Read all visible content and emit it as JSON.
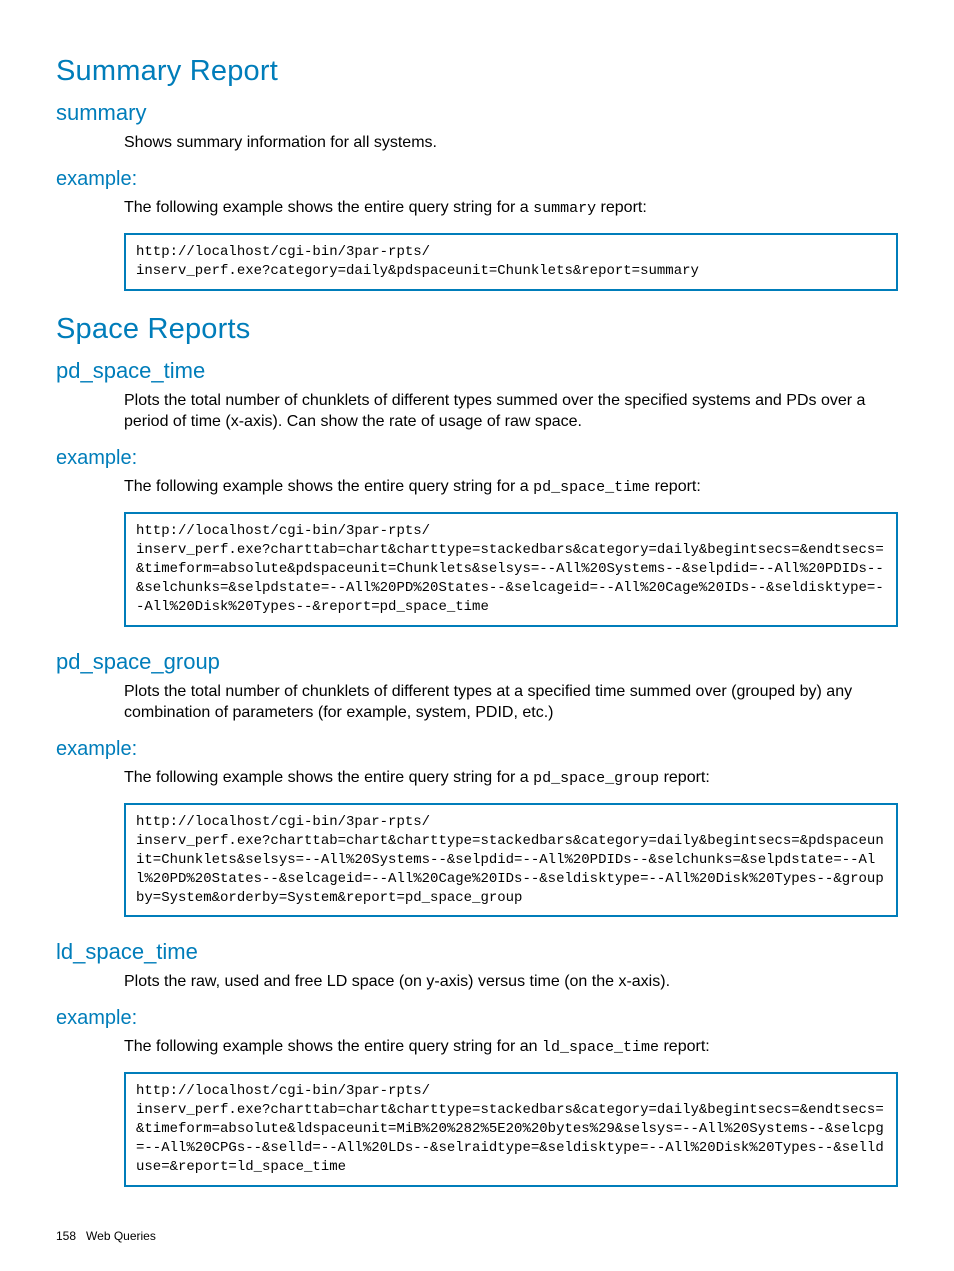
{
  "headings": {
    "summary_report": "Summary Report",
    "summary": "summary",
    "example": "example:",
    "space_reports": "Space Reports",
    "pd_space_time": "pd_space_time",
    "pd_space_group": "pd_space_group",
    "ld_space_time": "ld_space_time"
  },
  "text": {
    "summary_desc": "Shows summary information for all systems.",
    "summary_example_prefix": "The following example shows the entire query string for a ",
    "summary_example_code": "summary",
    "summary_example_suffix": " report:",
    "pd_space_time_desc": "Plots the total number of chunklets of different types summed over the specified systems and PDs over a period of time (x-axis). Can show the rate of usage of raw space.",
    "pd_space_time_example_prefix": "The following example shows the entire query string for a ",
    "pd_space_time_example_code": "pd_space_time",
    "pd_space_time_example_suffix": " report:",
    "pd_space_group_desc": "Plots the total number of chunklets of different types at a specified time summed over (grouped by) any combination of parameters (for example, system, PDID, etc.)",
    "pd_space_group_example_prefix": "The following example shows the entire query string for a ",
    "pd_space_group_example_code": "pd_space_group",
    "pd_space_group_example_suffix": " report:",
    "ld_space_time_desc": "Plots the raw, used and free LD space (on y-axis) versus time (on the x-axis).",
    "ld_space_time_example_prefix": "The following example shows the entire query string for an ",
    "ld_space_time_example_code": "ld_space_time",
    "ld_space_time_example_suffix": " report:"
  },
  "code": {
    "summary_block": "http://localhost/cgi-bin/3par-rpts/\ninserv_perf.exe?category=daily&pdspaceunit=Chunklets&report=summary",
    "pd_space_time_block": "http://localhost/cgi-bin/3par-rpts/\ninserv_perf.exe?charttab=chart&charttype=stackedbars&category=daily&begintsecs=&endtsecs=&timeform=absolute&pdspaceunit=Chunklets&selsys=--All%20Systems--&selpdid=--All%20PDIDs--&selchunks=&selpdstate=--All%20PD%20States--&selcageid=--All%20Cage%20IDs--&seldisktype=--All%20Disk%20Types--&report=pd_space_time",
    "pd_space_group_block": "http://localhost/cgi-bin/3par-rpts/\ninserv_perf.exe?charttab=chart&charttype=stackedbars&category=daily&begintsecs=&pdspaceunit=Chunklets&selsys=--All%20Systems--&selpdid=--All%20PDIDs--&selchunks=&selpdstate=--All%20PD%20States--&selcageid=--All%20Cage%20IDs--&seldisktype=--All%20Disk%20Types--&groupby=System&orderby=System&report=pd_space_group",
    "ld_space_time_block": "http://localhost/cgi-bin/3par-rpts/\ninserv_perf.exe?charttab=chart&charttype=stackedbars&category=daily&begintsecs=&endtsecs=&timeform=absolute&ldspaceunit=MiB%20%282%5E20%20bytes%29&selsys=--All%20Systems--&selcpg=--All%20CPGs--&selld=--All%20LDs--&selraidtype=&seldisktype=--All%20Disk%20Types--&sellduse=&report=ld_space_time"
  },
  "footer": {
    "page_number": "158",
    "section": "Web Queries"
  }
}
